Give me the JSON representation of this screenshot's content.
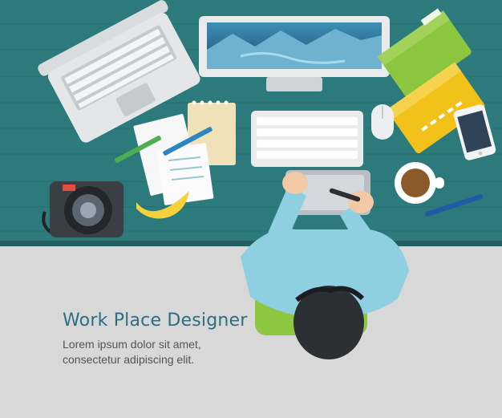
{
  "caption": {
    "title": "Work Place Designer",
    "body_line1": "Lorem ipsum dolor sit amet,",
    "body_line2": "consectetur adipiscing elit."
  },
  "colors": {
    "desk": "#2d7a7c",
    "floor": "#d8d8d8",
    "accent": "#2b6f80",
    "shirt": "#8ed0e2",
    "chair": "#8dc63f",
    "folder_yellow": "#f2c21b",
    "folder_green": "#8cc63f"
  }
}
